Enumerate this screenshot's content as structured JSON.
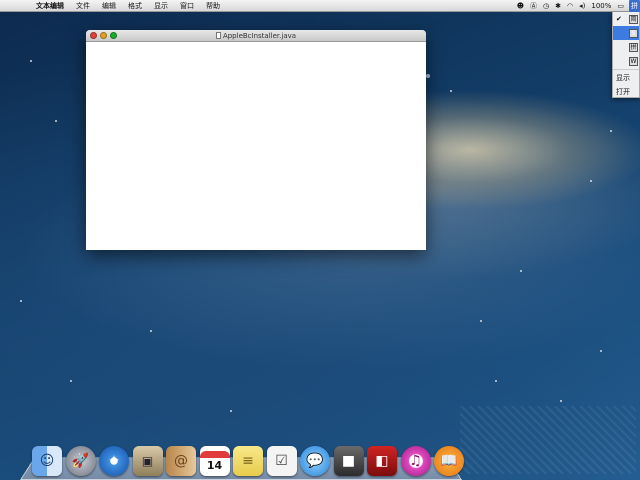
{
  "menubar": {
    "apple_glyph": "",
    "items": [
      "文本编辑",
      "文件",
      "编辑",
      "格式",
      "显示",
      "窗口",
      "帮助"
    ],
    "status": {
      "qq_icon": "penguin-icon",
      "battery": "100%",
      "input_source": "拼"
    }
  },
  "window": {
    "title": "AppleBcInstaller.java"
  },
  "input_menu": {
    "items": [
      {
        "label": "简",
        "checked": true,
        "icon": "flag-icon"
      },
      {
        "label": "S",
        "selected": true,
        "icon": "sogou-icon"
      },
      {
        "label": "拼",
        "icon": "pinyin-icon"
      },
      {
        "label": "W",
        "icon": "wubi-icon"
      }
    ],
    "show_label": "显示",
    "open_label": "打开"
  },
  "dock": {
    "calendar_day": "14",
    "items": [
      {
        "name": "finder",
        "glyph": "☺"
      },
      {
        "name": "launchpad",
        "glyph": "🚀"
      },
      {
        "name": "safari",
        "glyph": "✦"
      },
      {
        "name": "preview",
        "glyph": "▣"
      },
      {
        "name": "contacts",
        "glyph": "@"
      },
      {
        "name": "calendar"
      },
      {
        "name": "notes",
        "glyph": "≡"
      },
      {
        "name": "reminders",
        "glyph": "☑"
      },
      {
        "name": "messages",
        "glyph": "💬"
      },
      {
        "name": "facetime",
        "glyph": "■"
      },
      {
        "name": "photo-booth",
        "glyph": "◧"
      },
      {
        "name": "itunes",
        "glyph": "♫"
      },
      {
        "name": "ibooks",
        "glyph": "📖"
      }
    ]
  }
}
